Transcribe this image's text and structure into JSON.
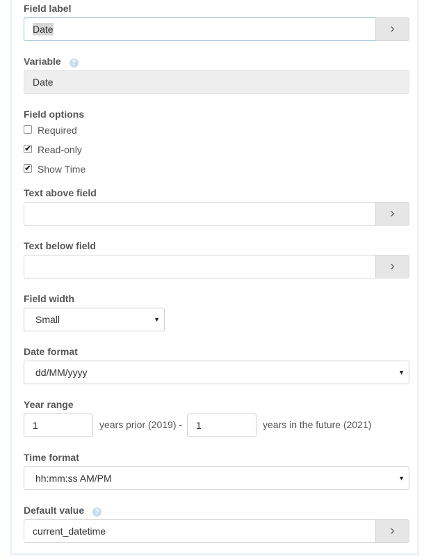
{
  "field_label": {
    "label": "Field label",
    "value": "Date",
    "button": "›"
  },
  "variable": {
    "label": "Variable",
    "help": "?",
    "value": "Date"
  },
  "field_options": {
    "label": "Field options",
    "items": [
      {
        "label": "Required",
        "checked": false,
        "mark": ""
      },
      {
        "label": "Read-only",
        "checked": true,
        "mark": "✔"
      },
      {
        "label": "Show Time",
        "checked": true,
        "mark": "✔"
      }
    ]
  },
  "text_above": {
    "label": "Text above field",
    "value": "",
    "button": "›"
  },
  "text_below": {
    "label": "Text below field",
    "value": "",
    "button": "›"
  },
  "field_width": {
    "label": "Field width",
    "selected": "Small",
    "arrow": "▼"
  },
  "date_format": {
    "label": "Date format",
    "selected": "dd/MM/yyyy",
    "arrow": "▼"
  },
  "year_range": {
    "label": "Year range",
    "prior_value": "1",
    "prior_text": "years prior (2019) -",
    "future_value": "1",
    "future_text": "years in the future (2021)"
  },
  "time_format": {
    "label": "Time format",
    "selected": "hh:mm:ss AM/PM",
    "arrow": "▼"
  },
  "default_value": {
    "label": "Default value",
    "help": "?",
    "value": "current_datetime",
    "button": "›"
  }
}
